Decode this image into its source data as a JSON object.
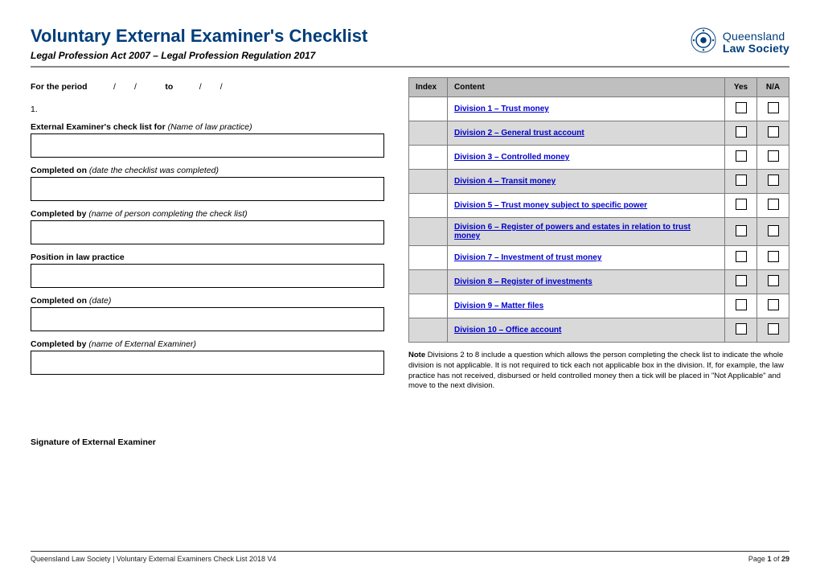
{
  "header": {
    "title": "Voluntary External Examiner's Checklist",
    "subtitle": "Legal Profession Act 2007 – Legal Profession Regulation 2017",
    "logo": {
      "line1": "Queensland",
      "line2": "Law Society"
    }
  },
  "left": {
    "period_prefix": "For the period",
    "period_to": "to",
    "item_number": "1.",
    "fields": [
      {
        "bold": "External Examiner's check list for ",
        "italic": "(Name of law practice)"
      },
      {
        "bold": "Completed on ",
        "italic": "(date the checklist was completed)"
      },
      {
        "bold": "Completed by ",
        "italic": "(name of person completing the check list)"
      },
      {
        "bold": "Position in law practice",
        "italic": ""
      },
      {
        "bold": "Completed on ",
        "italic": "(date)"
      },
      {
        "bold": "Completed by ",
        "italic": "(name of External Examiner)"
      }
    ],
    "signature_label": "Signature of External Examiner"
  },
  "index": {
    "headers": {
      "index": "Index",
      "content": "Content",
      "yes": "Yes",
      "na": "N/A"
    },
    "rows": [
      {
        "label": "Division 1 – Trust money"
      },
      {
        "label": "Division 2 – General trust account"
      },
      {
        "label": "Division 3 – Controlled money"
      },
      {
        "label": "Division 4 – Transit money"
      },
      {
        "label": "Division 5 – Trust money subject to specific power"
      },
      {
        "label": "Division 6 – Register of powers and estates in relation to trust money"
      },
      {
        "label": "Division 7 – Investment of trust money"
      },
      {
        "label": "Division 8 – Register of investments"
      },
      {
        "label": "Division 9 – Matter files"
      },
      {
        "label": "Division 10 – Office account"
      }
    ],
    "note_bold": "Note",
    "note_text": " Divisions 2 to 8 include a question which allows the person completing the check list to indicate the whole division is not applicable. It is not required to tick each not applicable box in the division. If, for example, the law practice has not received, disbursed or held controlled money then a tick will be placed in \"Not Applicable\" and move to the next division."
  },
  "footer": {
    "left": "Queensland Law Society | Voluntary External Examiners Check List 2018 V4",
    "page_prefix": "Page ",
    "page_current": "1",
    "page_of": " of ",
    "page_total": "29"
  }
}
